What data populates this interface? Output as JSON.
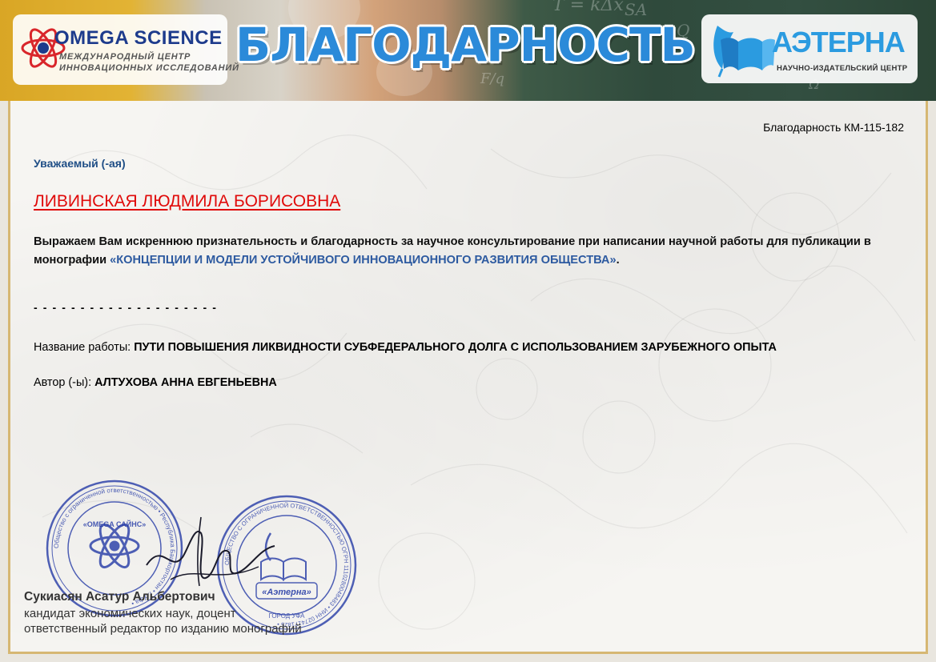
{
  "banner": {
    "left_logo": {
      "name": "OMEGA SCIENCE",
      "subtitle_line1": "МЕЖДУНАРОДНЫЙ ЦЕНТР",
      "subtitle_line2": "ИННОВАЦИОННЫХ ИССЛЕДОВАНИЙ",
      "icon": "atom-icon"
    },
    "title": "БЛАГОДАРНОСТЬ",
    "right_logo": {
      "name": "АЭТЕРНА",
      "subtitle": "НАУЧНО-ИЗДАТЕЛЬСКИЙ ЦЕНТР",
      "icon": "book-quill-icon"
    }
  },
  "document": {
    "number": "Благодарность КМ-115-182",
    "greeting": "Уважаемый (-ая)",
    "recipient": "ЛИВИНСКАЯ ЛЮДМИЛА БОРИСОВНА",
    "message_text": "Выражаем Вам искреннюю признательность и благодарность за научное консультирование при написании научной работы для публикации в монографии ",
    "monograph_title": "«КОНЦЕПЦИИ И МОДЕЛИ УСТОЙЧИВОГО ИННОВАЦИОННОГО РАЗВИТИЯ ОБЩЕСТВА»",
    "message_end": ".",
    "separator": "- - - - - - - - - - - - - - - - - - - -",
    "work_label": "Название работы: ",
    "work_title": "ПУТИ ПОВЫШЕНИЯ ЛИКВИДНОСТИ СУБФЕДЕРАЛЬНОГО ДОЛГА С ИСПОЛЬЗОВАНИЕМ ЗАРУБЕЖНОГО ОПЫТА",
    "author_label": "Автор (-ы): ",
    "author_name": "АЛТУХОВА АННА ЕВГЕНЬЕВНА"
  },
  "signatory": {
    "name": "Сукиасян Асатур Альбертович",
    "degree": "кандидат экономических наук, доцент",
    "role": "ответственный редактор по изданию монографий"
  },
  "stamps": {
    "omega_center_text": "«OMEGA САЙНС»",
    "omega_ring_text": "Общество с ограниченной ответственностью • Республика Башкортостан • г. Уфа •",
    "aeterna_center_text": "«Аэтерна»",
    "aeterna_ring_text": "ОБЩЕСТВО С ОГРАНИЧЕННОЙ ОТВЕТСТВЕННОСТЬЮ ОГРН 1110280048483 • ИНН 0274171825 •",
    "aeterna_city": "ГОРОД УФА"
  },
  "colors": {
    "title_blue": "#2b8ad9",
    "recipient_red": "#e00a0a",
    "greeting_blue": "#1f4e86",
    "monograph_blue": "#2d5aa0",
    "frame_gold": "#d6b773",
    "stamp_blue": "#2a3fa8"
  }
}
